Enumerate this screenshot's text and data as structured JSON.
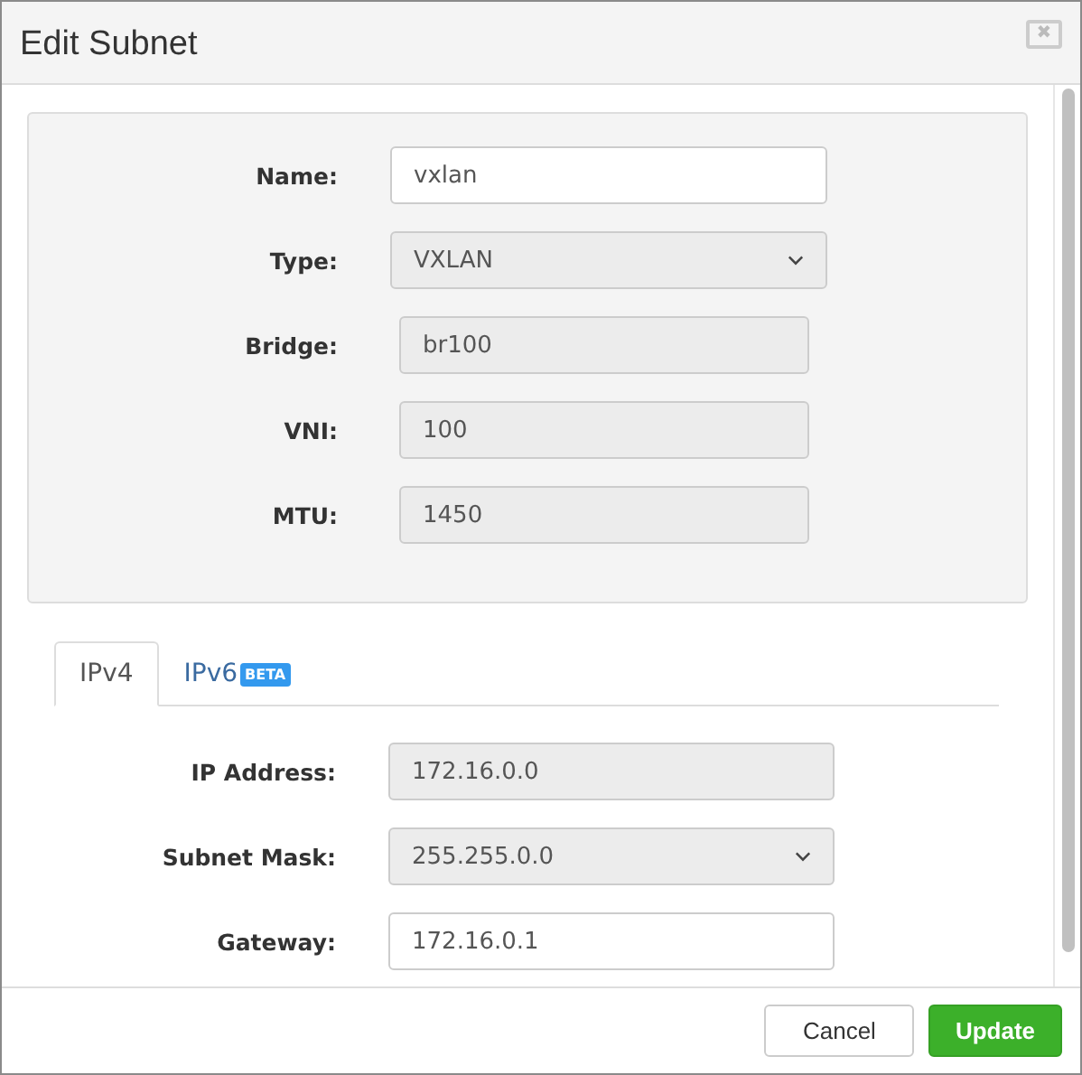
{
  "window": {
    "title": "Edit Subnet",
    "close": "✖"
  },
  "fields": [
    {
      "label": "Name:",
      "value": "vxlan",
      "kind": "text"
    },
    {
      "label": "Type:",
      "value": "VXLAN",
      "kind": "select"
    },
    {
      "label": "Bridge:",
      "value": "br100",
      "kind": "readonly"
    },
    {
      "label": "VNI:",
      "value": "100",
      "kind": "readonly"
    },
    {
      "label": "MTU:",
      "value": "1450",
      "kind": "readonly"
    }
  ],
  "tabs": [
    {
      "label": "IPv4",
      "selected": true
    },
    {
      "label": "IPv6",
      "badge": "BETA",
      "selected": false
    }
  ],
  "ip_fields": [
    {
      "label": "IP Address:",
      "value": "172.16.0.0",
      "kind": "readonly"
    },
    {
      "label": "Subnet Mask:",
      "value": "255.255.0.0",
      "kind": "select"
    },
    {
      "label": "Gateway:",
      "value": "172.16.0.1",
      "kind": "text"
    }
  ],
  "buttons": [
    {
      "label": "Cancel",
      "kind": "default"
    },
    {
      "label": "Update",
      "kind": "primary"
    }
  ]
}
